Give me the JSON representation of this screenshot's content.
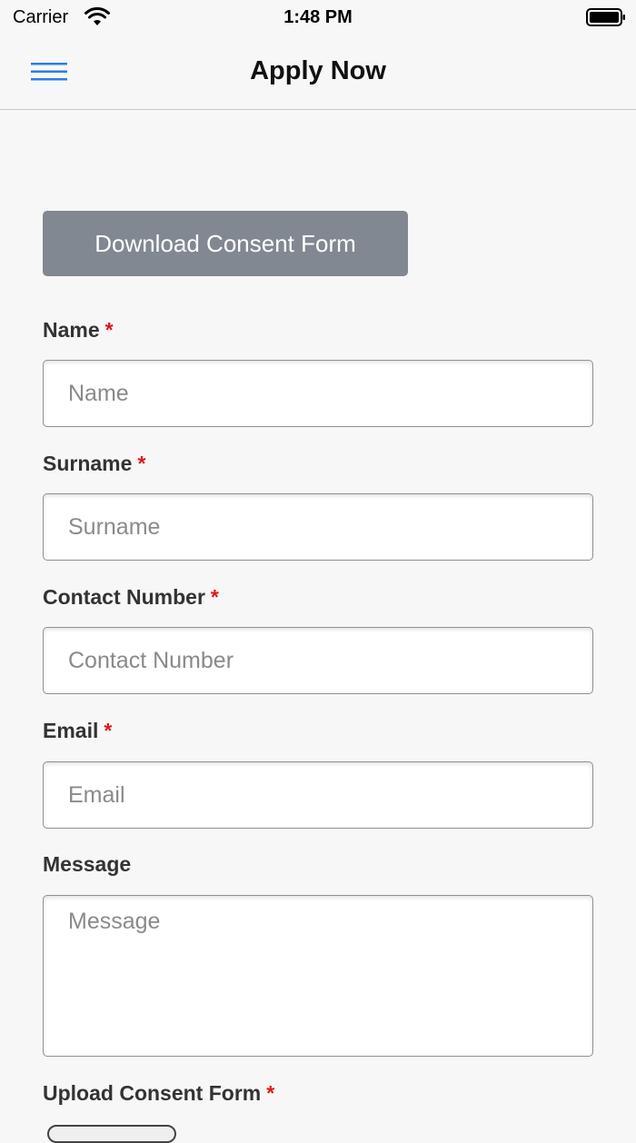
{
  "status_bar": {
    "carrier": "Carrier",
    "time": "1:48 PM",
    "wifi_icon": "wifi-icon",
    "battery_icon": "battery-full-icon"
  },
  "nav": {
    "title": "Apply Now",
    "menu_icon": "hamburger-menu-icon",
    "accent_color": "#2b7de9"
  },
  "download_button": {
    "label": "Download Consent Form",
    "color": "#818891"
  },
  "form": {
    "required_marker": "*",
    "name": {
      "label": "Name",
      "placeholder": "Name"
    },
    "surname": {
      "label": "Surname",
      "placeholder": "Surname"
    },
    "contact": {
      "label": "Contact Number",
      "placeholder": "Contact Number"
    },
    "email": {
      "label": "Email",
      "placeholder": "Email"
    },
    "message": {
      "label": "Message",
      "placeholder": "Message"
    },
    "upload": {
      "label": "Upload Consent Form"
    }
  }
}
